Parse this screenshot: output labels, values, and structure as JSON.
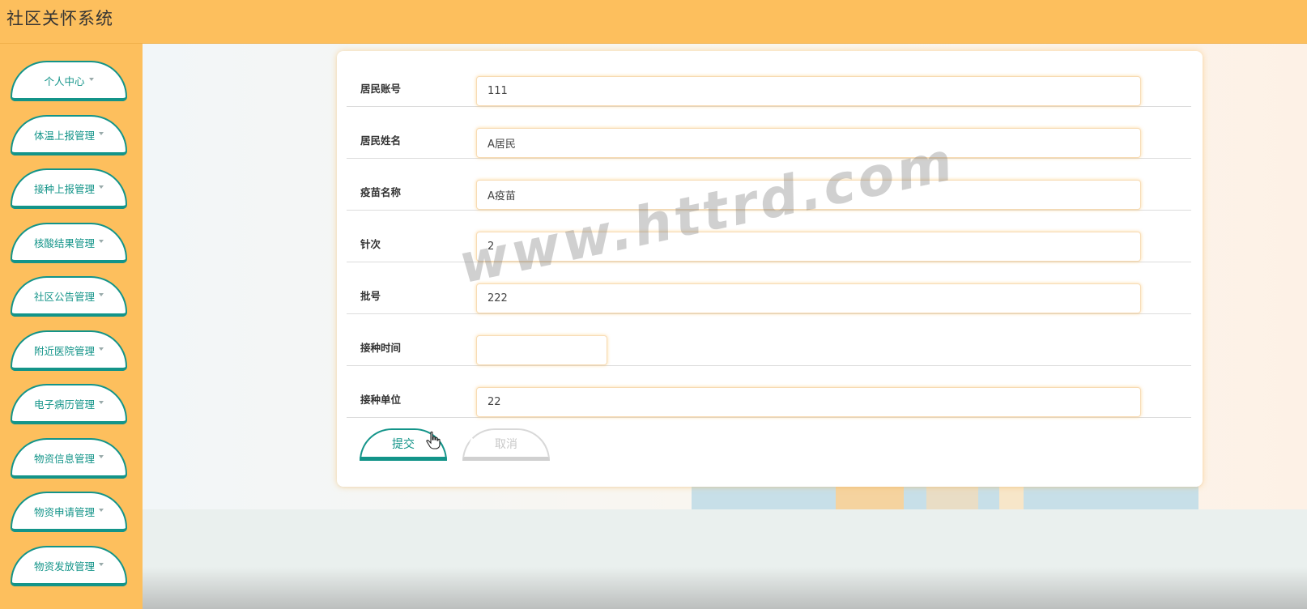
{
  "app": {
    "title": "社区关怀系统"
  },
  "sidebar": {
    "items": [
      {
        "label": "个人中心"
      },
      {
        "label": "体温上报管理"
      },
      {
        "label": "接种上报管理"
      },
      {
        "label": "核酸结果管理"
      },
      {
        "label": "社区公告管理"
      },
      {
        "label": "附近医院管理"
      },
      {
        "label": "电子病历管理"
      },
      {
        "label": "物资信息管理"
      },
      {
        "label": "物资申请管理"
      },
      {
        "label": "物资发放管理"
      }
    ]
  },
  "form": {
    "fields": [
      {
        "label": "居民账号",
        "value": "111"
      },
      {
        "label": "居民姓名",
        "value": "A居民"
      },
      {
        "label": "疫苗名称",
        "value": "A疫苗"
      },
      {
        "label": "针次",
        "value": "2"
      },
      {
        "label": "批号",
        "value": "222"
      },
      {
        "label": "接种时间",
        "value": ""
      },
      {
        "label": "接种单位",
        "value": "22"
      }
    ],
    "submit_label": "提交",
    "cancel_label": "取消"
  },
  "watermark": "www.httrd.com",
  "colors": {
    "header": "#fdbf5d",
    "accent": "#139489",
    "cancel": "#d0d0d0"
  }
}
